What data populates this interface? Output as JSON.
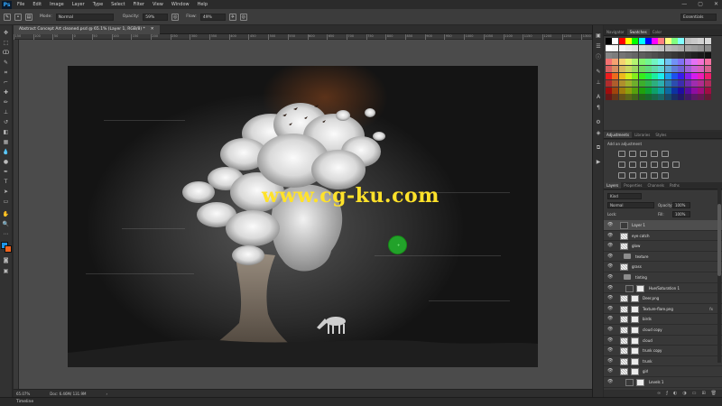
{
  "menubar": {
    "logo": "Ps",
    "items": [
      "File",
      "Edit",
      "Image",
      "Layer",
      "Type",
      "Select",
      "Filter",
      "View",
      "Window",
      "Help"
    ],
    "window_controls": [
      "—",
      "▢",
      "✕"
    ]
  },
  "options": {
    "mode_label": "Mode:",
    "mode_value": "Normal",
    "opacity_label": "Opacity:",
    "opacity_value": "59%",
    "flow_label": "Flow:",
    "flow_value": "49%",
    "workspace": "Essentials"
  },
  "document": {
    "tab_title": "Abstract Concept Art cleaned.psd @ 65.1% (Layer 1, RGB/8) *",
    "tab_close": "✕",
    "ruler_numbers": [
      "150",
      "100",
      "50",
      "0",
      "50",
      "100",
      "150",
      "200",
      "250",
      "300",
      "350",
      "400",
      "450",
      "500",
      "550",
      "600",
      "650",
      "700",
      "750",
      "800",
      "850",
      "900",
      "950",
      "1000",
      "1050",
      "1100",
      "1150",
      "1200",
      "1250",
      "1300"
    ],
    "watermark": "www.cg-ku.com"
  },
  "status": {
    "zoom": "65.07%",
    "doc": "Doc: 6.46M/ 131.9M",
    "arrow": "›"
  },
  "timeline_label": "Timeline",
  "panel_tabs_top": [
    "Navigator",
    "Swatches",
    "Color"
  ],
  "adjustments": {
    "tabs": [
      "Adjustments",
      "Libraries",
      "Styles"
    ],
    "title": "Add an adjustment"
  },
  "layers_panel": {
    "tabs": [
      "Layers",
      "Properties",
      "Channels",
      "Paths"
    ],
    "kind": "Kind",
    "blend": "Normal",
    "opacity_label": "Opacity:",
    "opacity": "100%",
    "lock_label": "Lock:",
    "fill_label": "Fill:",
    "fill": "100%",
    "layers": [
      {
        "name": "Layer 1",
        "type": "dark",
        "selected": true
      },
      {
        "name": "eye catch",
        "type": "check"
      },
      {
        "name": "glow",
        "type": "check"
      },
      {
        "name": "texture",
        "type": "folder"
      },
      {
        "name": "grass",
        "type": "check"
      },
      {
        "name": "tinting",
        "type": "folder"
      },
      {
        "name": "Hue/Saturation 1",
        "type": "adj"
      },
      {
        "name": "Deer.png",
        "type": "mask"
      },
      {
        "name": "Texture-flare.png",
        "type": "mask",
        "fx": "fx"
      },
      {
        "name": "birds",
        "type": "mask"
      },
      {
        "name": "cloud copy",
        "type": "mask"
      },
      {
        "name": "cloud",
        "type": "mask"
      },
      {
        "name": "trunk copy",
        "type": "mask"
      },
      {
        "name": "trunk",
        "type": "mask"
      },
      {
        "name": "girl",
        "type": "mask"
      },
      {
        "name": "Levels 1",
        "type": "adj"
      }
    ],
    "footer_icons": [
      "link-icon",
      "fx-icon",
      "mask-icon",
      "adjustment-icon",
      "folder-icon",
      "new-layer-icon",
      "trash-icon"
    ]
  },
  "colors": {
    "accent": "#31a8ff",
    "watermark": "#ffe22a",
    "cursor": "#22a22a"
  }
}
